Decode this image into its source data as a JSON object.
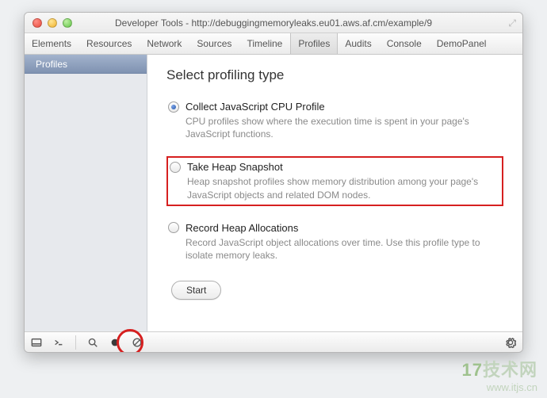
{
  "window": {
    "title": "Developer Tools - http://debuggingmemoryleaks.eu01.aws.af.cm/example/9"
  },
  "toolbar": {
    "tabs": [
      {
        "label": "Elements"
      },
      {
        "label": "Resources"
      },
      {
        "label": "Network"
      },
      {
        "label": "Sources"
      },
      {
        "label": "Timeline"
      },
      {
        "label": "Profiles"
      },
      {
        "label": "Audits"
      },
      {
        "label": "Console"
      },
      {
        "label": "DemoPanel"
      }
    ],
    "active_index": 5
  },
  "sidebar": {
    "header": "Profiles"
  },
  "main": {
    "title": "Select profiling type",
    "options": [
      {
        "label": "Collect JavaScript CPU Profile",
        "desc": "CPU profiles show where the execution time is spent in your page's JavaScript functions.",
        "selected": true,
        "highlight": false
      },
      {
        "label": "Take Heap Snapshot",
        "desc": "Heap snapshot profiles show memory distribution among your page's JavaScript objects and related DOM nodes.",
        "selected": false,
        "highlight": true
      },
      {
        "label": "Record Heap Allocations",
        "desc": "Record JavaScript object allocations over time. Use this profile type to isolate memory leaks.",
        "selected": false,
        "highlight": false
      }
    ],
    "start_label": "Start"
  },
  "watermark": {
    "top_prefix": "17",
    "top_suffix": "技术网",
    "sub": "www.itjs.cn"
  }
}
